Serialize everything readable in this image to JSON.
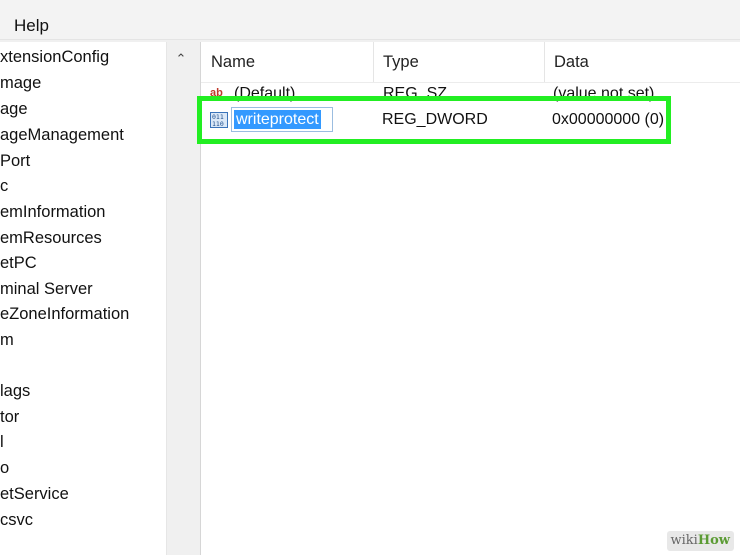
{
  "menubar": {
    "help_label": "Help"
  },
  "tree": {
    "items": [
      "xtensionConfig",
      "mage",
      "age",
      "ageManagement",
      "Port",
      "c",
      "emInformation",
      "emResources",
      "etPC",
      "minal Server",
      "eZoneInformation",
      "m",
      "",
      "lags",
      "tor",
      "l",
      "o",
      "etService",
      "csvc"
    ]
  },
  "list": {
    "columns": {
      "name": "Name",
      "type": "Type",
      "data": "Data"
    },
    "rows": [
      {
        "icon": "string-value-icon",
        "name": "(Default)",
        "type": "REG_SZ",
        "data": "(value not set)"
      },
      {
        "icon": "binary-value-icon",
        "name": "writeprotect",
        "type": "REG_DWORD",
        "data": "0x00000000 (0)",
        "editing": true
      }
    ]
  },
  "highlight_color": "#22ee22",
  "selection_color": "#3399ff",
  "watermark": {
    "part1": "wiki",
    "part2": "How"
  }
}
